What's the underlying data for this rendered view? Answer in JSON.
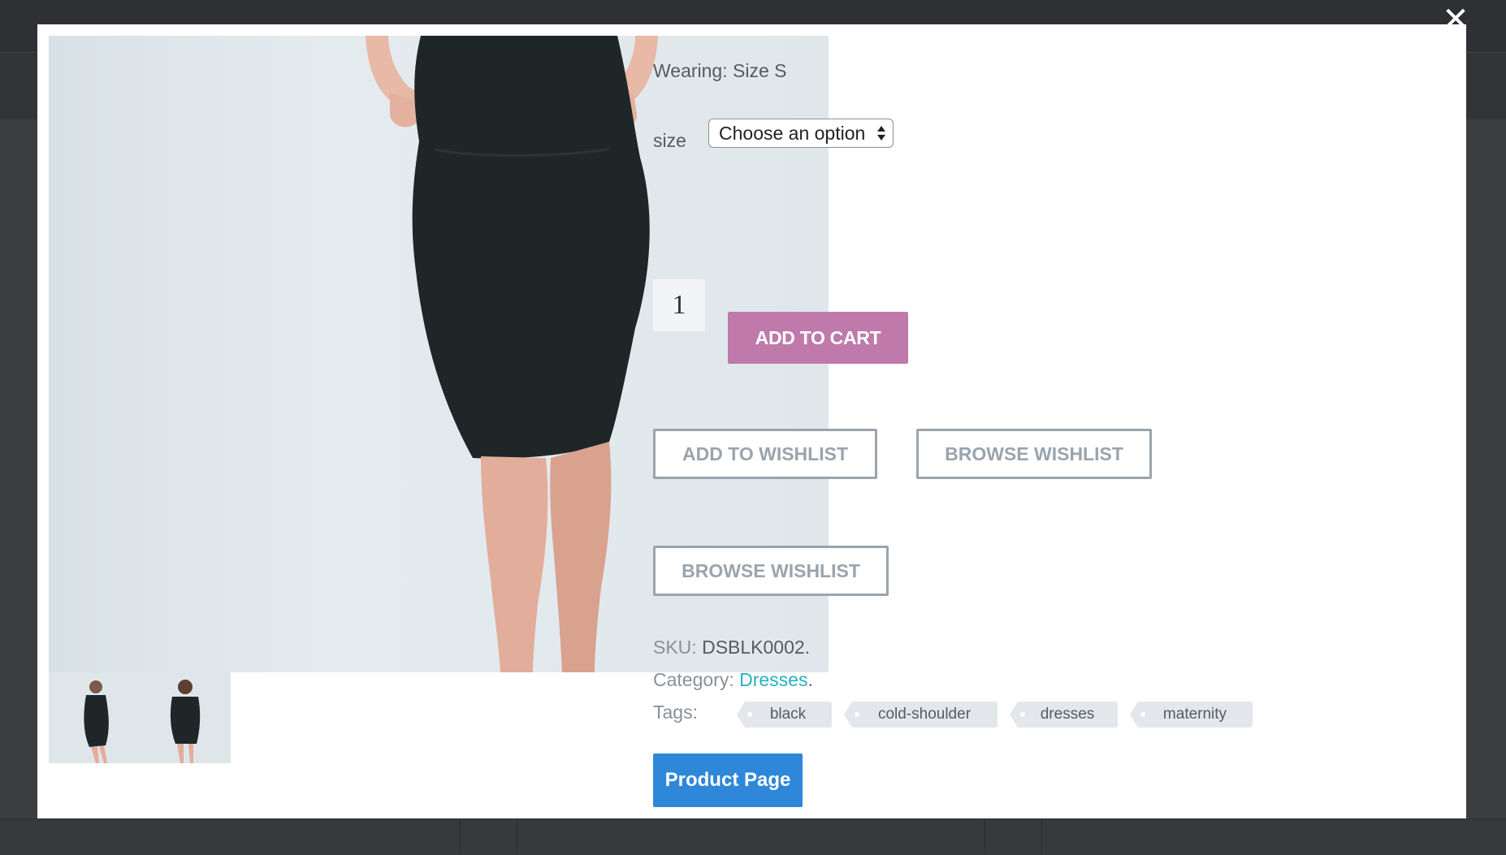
{
  "modal": {
    "close_symbol": "✕"
  },
  "product": {
    "wearing": "Wearing: Size S",
    "size": {
      "label": "size",
      "selected": "Choose an option"
    },
    "quantity": "1",
    "add_to_cart": "ADD TO CART",
    "add_to_wishlist": "ADD TO WISHLIST",
    "browse_wishlist_1": "BROWSE WISHLIST",
    "browse_wishlist_2": "BROWSE WISHLIST",
    "sku_label": "SKU:",
    "sku_value": "DSBLK0002.",
    "category_label": "Category:",
    "category_value": "Dresses",
    "category_suffix": ".",
    "tags_label": "Tags:",
    "tags": [
      "black",
      "cold-shoulder",
      "dresses",
      "maternity"
    ],
    "product_page_button": "Product Page"
  },
  "colors": {
    "add_to_cart_bg": "#bf7aab",
    "wishlist_border": "#9aa4ad",
    "category_link": "#27b1c0",
    "product_page_bg": "#2e87d9",
    "overlay": "#3c3d3f",
    "dress": "#1f2628"
  },
  "icons": {
    "close": "close-icon",
    "select_arrows": "select-arrows-icon",
    "tag": "tag-icon"
  }
}
